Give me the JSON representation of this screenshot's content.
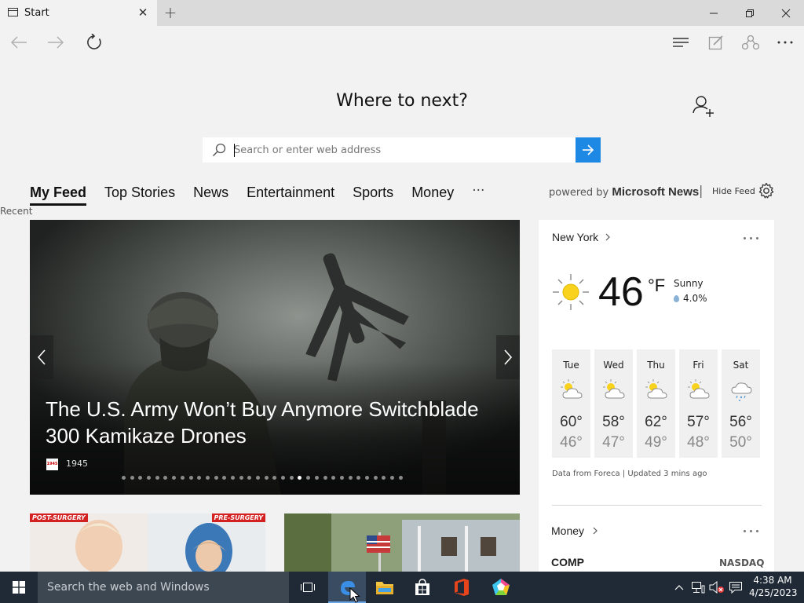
{
  "browser": {
    "tab_title": "Start",
    "tab_close": "✕",
    "new_tab": "+"
  },
  "page": {
    "headline": "Where to next?",
    "search_placeholder": "Search or enter web address",
    "feed_tabs": [
      "My Feed",
      "Top Stories",
      "News",
      "Entertainment",
      "Sports",
      "Money"
    ],
    "feed_more": "···",
    "powered_by_prefix": "powered by ",
    "powered_by_brand": "Microsoft News",
    "separator": "|",
    "hide_feed": "Hide Feed",
    "recent": "Recent"
  },
  "hero": {
    "title": "The U.S. Army Won’t Buy Anymore Switchblade 300 Kamikaze Drones",
    "source_logo": "1945",
    "source": "1945",
    "dot_count": 34,
    "active_dot": 21
  },
  "thumbs": {
    "tag_left": "POST-SURGERY",
    "tag_right": "PRE-SURGERY"
  },
  "weather": {
    "location": "New York",
    "temp": "46",
    "unit": "°F",
    "condition": "Sunny",
    "precip": "4.0%",
    "days": [
      {
        "name": "Tue",
        "hi": "60°",
        "lo": "46°",
        "icon": "partly-sunny-icon"
      },
      {
        "name": "Wed",
        "hi": "58°",
        "lo": "47°",
        "icon": "partly-sunny-icon"
      },
      {
        "name": "Thu",
        "hi": "62°",
        "lo": "49°",
        "icon": "partly-sunny-icon"
      },
      {
        "name": "Fri",
        "hi": "57°",
        "lo": "48°",
        "icon": "partly-sunny-icon"
      },
      {
        "name": "Sat",
        "hi": "56°",
        "lo": "50°",
        "icon": "rain-snow-icon"
      }
    ],
    "source": "Data from Foreca | Updated 3 mins ago"
  },
  "money": {
    "title": "Money",
    "symbol": "COMP",
    "exchange": "NASDAQ"
  },
  "taskbar": {
    "search_text": "Search the web and Windows",
    "time": "4:38 AM",
    "date": "4/25/2023"
  },
  "colors": {
    "accent": "#1e88e5",
    "taskbar": "#1f2a36"
  }
}
